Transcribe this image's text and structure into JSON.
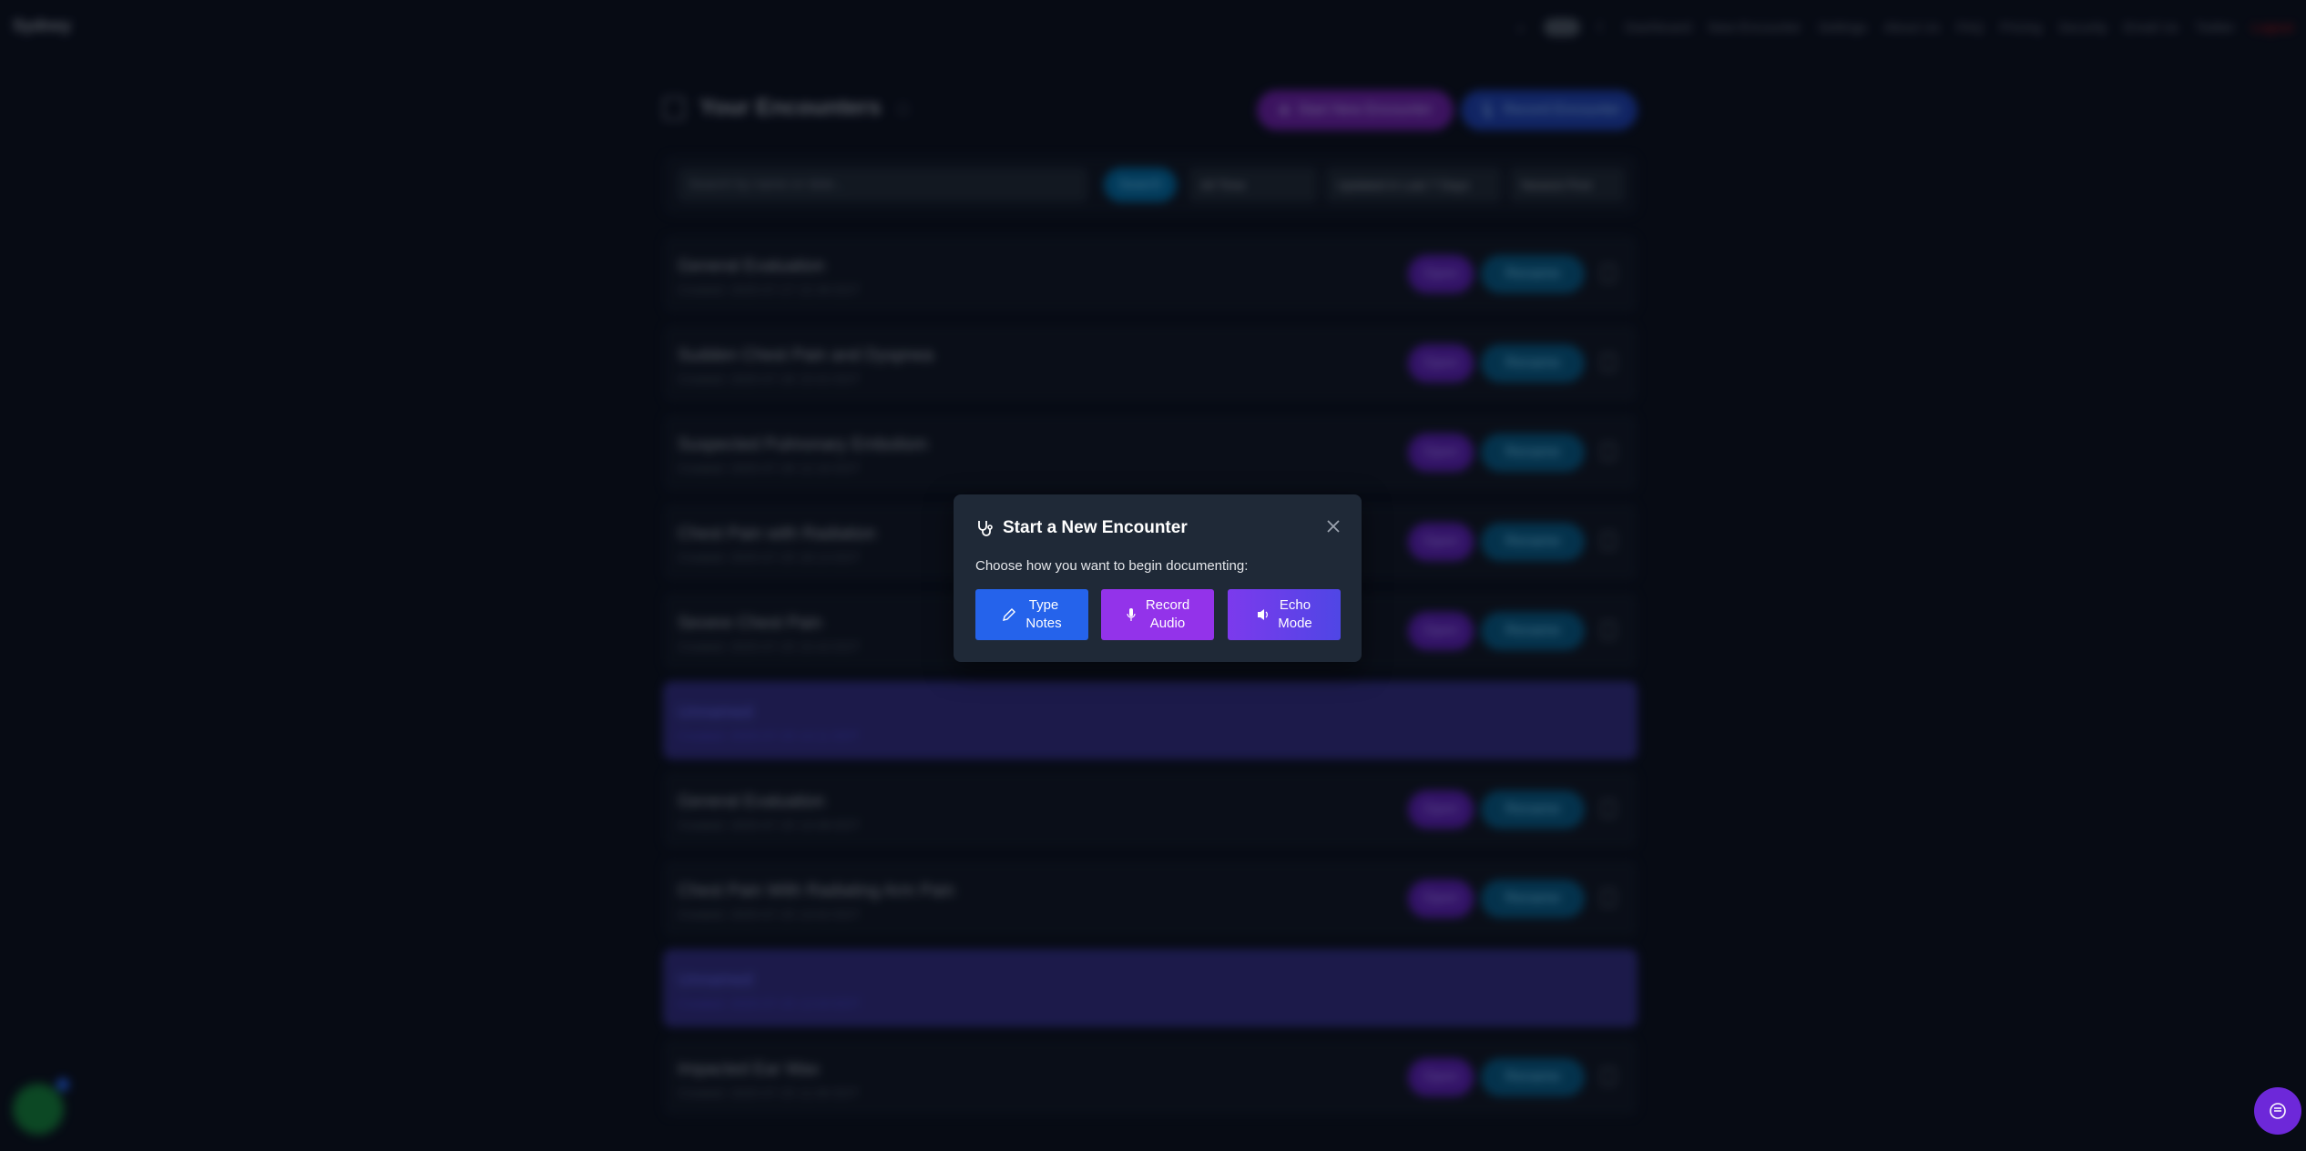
{
  "nav": {
    "brand": "Sydney",
    "links": [
      "Dashboard",
      "New Encounter",
      "Settings",
      "About Us",
      "FAQ",
      "Pricing",
      "Security",
      "Email Us",
      "Twitter"
    ],
    "logout": "Logout"
  },
  "encounters": {
    "title": "Your Encounters",
    "start_button": "Start New Encounter",
    "record_button": "Record Encounter",
    "search_placeholder": "Search by name or date...",
    "search_button": "Search",
    "filter_time": "All Time",
    "filter_updated": "Updated in Last 7 Days",
    "filter_sort": "Newest First",
    "rows": [
      {
        "title": "General Evaluation",
        "date": "Created: 2025-07-27 22:36 EDT",
        "highlight": false
      },
      {
        "title": "Sudden Chest Pain and Dyspnea",
        "date": "Created: 2025-07-26 15:02 EDT",
        "highlight": false
      },
      {
        "title": "Suspected Pulmonary Embolism",
        "date": "Created: 2025-07-26 12:16 EDT",
        "highlight": false
      },
      {
        "title": "Chest Pain with Radiation",
        "date": "Created: 2025-07-25 18:13 EDT",
        "highlight": false
      },
      {
        "title": "Severe Chest Pain",
        "date": "Created: 2025-07-25 15:43 EDT",
        "highlight": false
      },
      {
        "title": "Unnamed",
        "date": "Created: 2025-07-25 14:11 EDT",
        "highlight": true
      },
      {
        "title": "General Evaluation",
        "date": "Created: 2025-07-25 13:38 EDT",
        "highlight": false
      },
      {
        "title": "Chest Pain With Radiating Arm Pain",
        "date": "Created: 2025-07-25 13:02 EDT",
        "highlight": false
      },
      {
        "title": "Unnamed",
        "date": "Created: 2025-07-25 12:03 EDT",
        "highlight": true
      },
      {
        "title": "Impacted Ear Wax",
        "date": "Created: 2025-07-25 11:06 EDT",
        "highlight": false
      }
    ],
    "open_label": "Open",
    "rename_label": "Rename"
  },
  "modal": {
    "title": "Start a New Encounter",
    "description": "Choose how you want to begin documenting:",
    "options": [
      {
        "line1": "Type",
        "line2": "Notes",
        "icon": "pencil-icon"
      },
      {
        "line1": "Record",
        "line2": "Audio",
        "icon": "microphone-icon"
      },
      {
        "line1": "Echo",
        "line2": "Mode",
        "icon": "speaker-icon"
      }
    ]
  },
  "colors": {
    "background": "#0b1120",
    "modal": "#1f2937",
    "type_notes": "#2563eb",
    "record_audio": "#9333ea",
    "echo_mode": "#7c3aed"
  }
}
